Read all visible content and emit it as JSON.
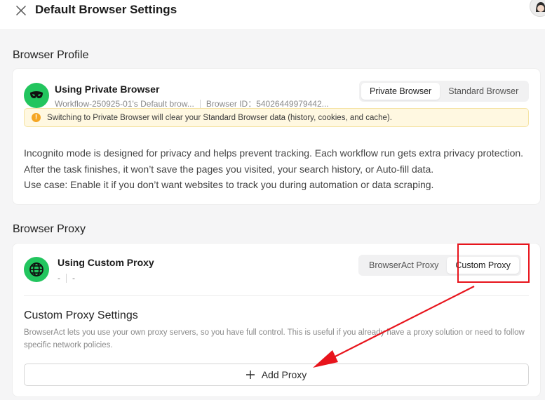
{
  "header": {
    "title": "Default Browser Settings"
  },
  "browser_profile": {
    "section_title": "Browser Profile",
    "heading": "Using Private Browser",
    "profile_name": "Workflow-250925-01's Default brow...",
    "browser_id": "Browser ID：54026449979442...",
    "segments": [
      "Private Browser",
      "Standard Browser"
    ],
    "active_segment": "Private Browser",
    "warning": "Switching to Private Browser will clear your Standard Browser data (history, cookies, and cache).",
    "description": [
      "Incognito mode is designed for privacy and helps prevent tracking. Each workflow run gets extra privacy protection.",
      "After the task finishes, it won’t save the pages you visited, your search history, or Auto-fill data.",
      "Use case: Enable it if you don’t want websites to track you during automation or data scraping."
    ]
  },
  "browser_proxy": {
    "section_title": "Browser Proxy",
    "heading": "Using Custom Proxy",
    "meta_left": "-",
    "meta_right": "-",
    "segments": [
      "BrowserAct Proxy",
      "Custom Proxy"
    ],
    "active_segment": "Custom Proxy",
    "settings_title": "Custom Proxy Settings",
    "settings_desc": "BrowserAct lets you use your own proxy servers, so you have full control. This is useful if you already have a proxy solution or need to follow specific network policies.",
    "add_button": "Add Proxy"
  },
  "colors": {
    "accent_green": "#22c55e",
    "annotation_red": "#e8141c",
    "warning_bg": "#fff8e1"
  },
  "icons": {
    "close": "close-icon",
    "incognito": "incognito-mask-icon",
    "globe": "globe-icon",
    "warning": "warning-icon",
    "plus": "plus-icon"
  }
}
